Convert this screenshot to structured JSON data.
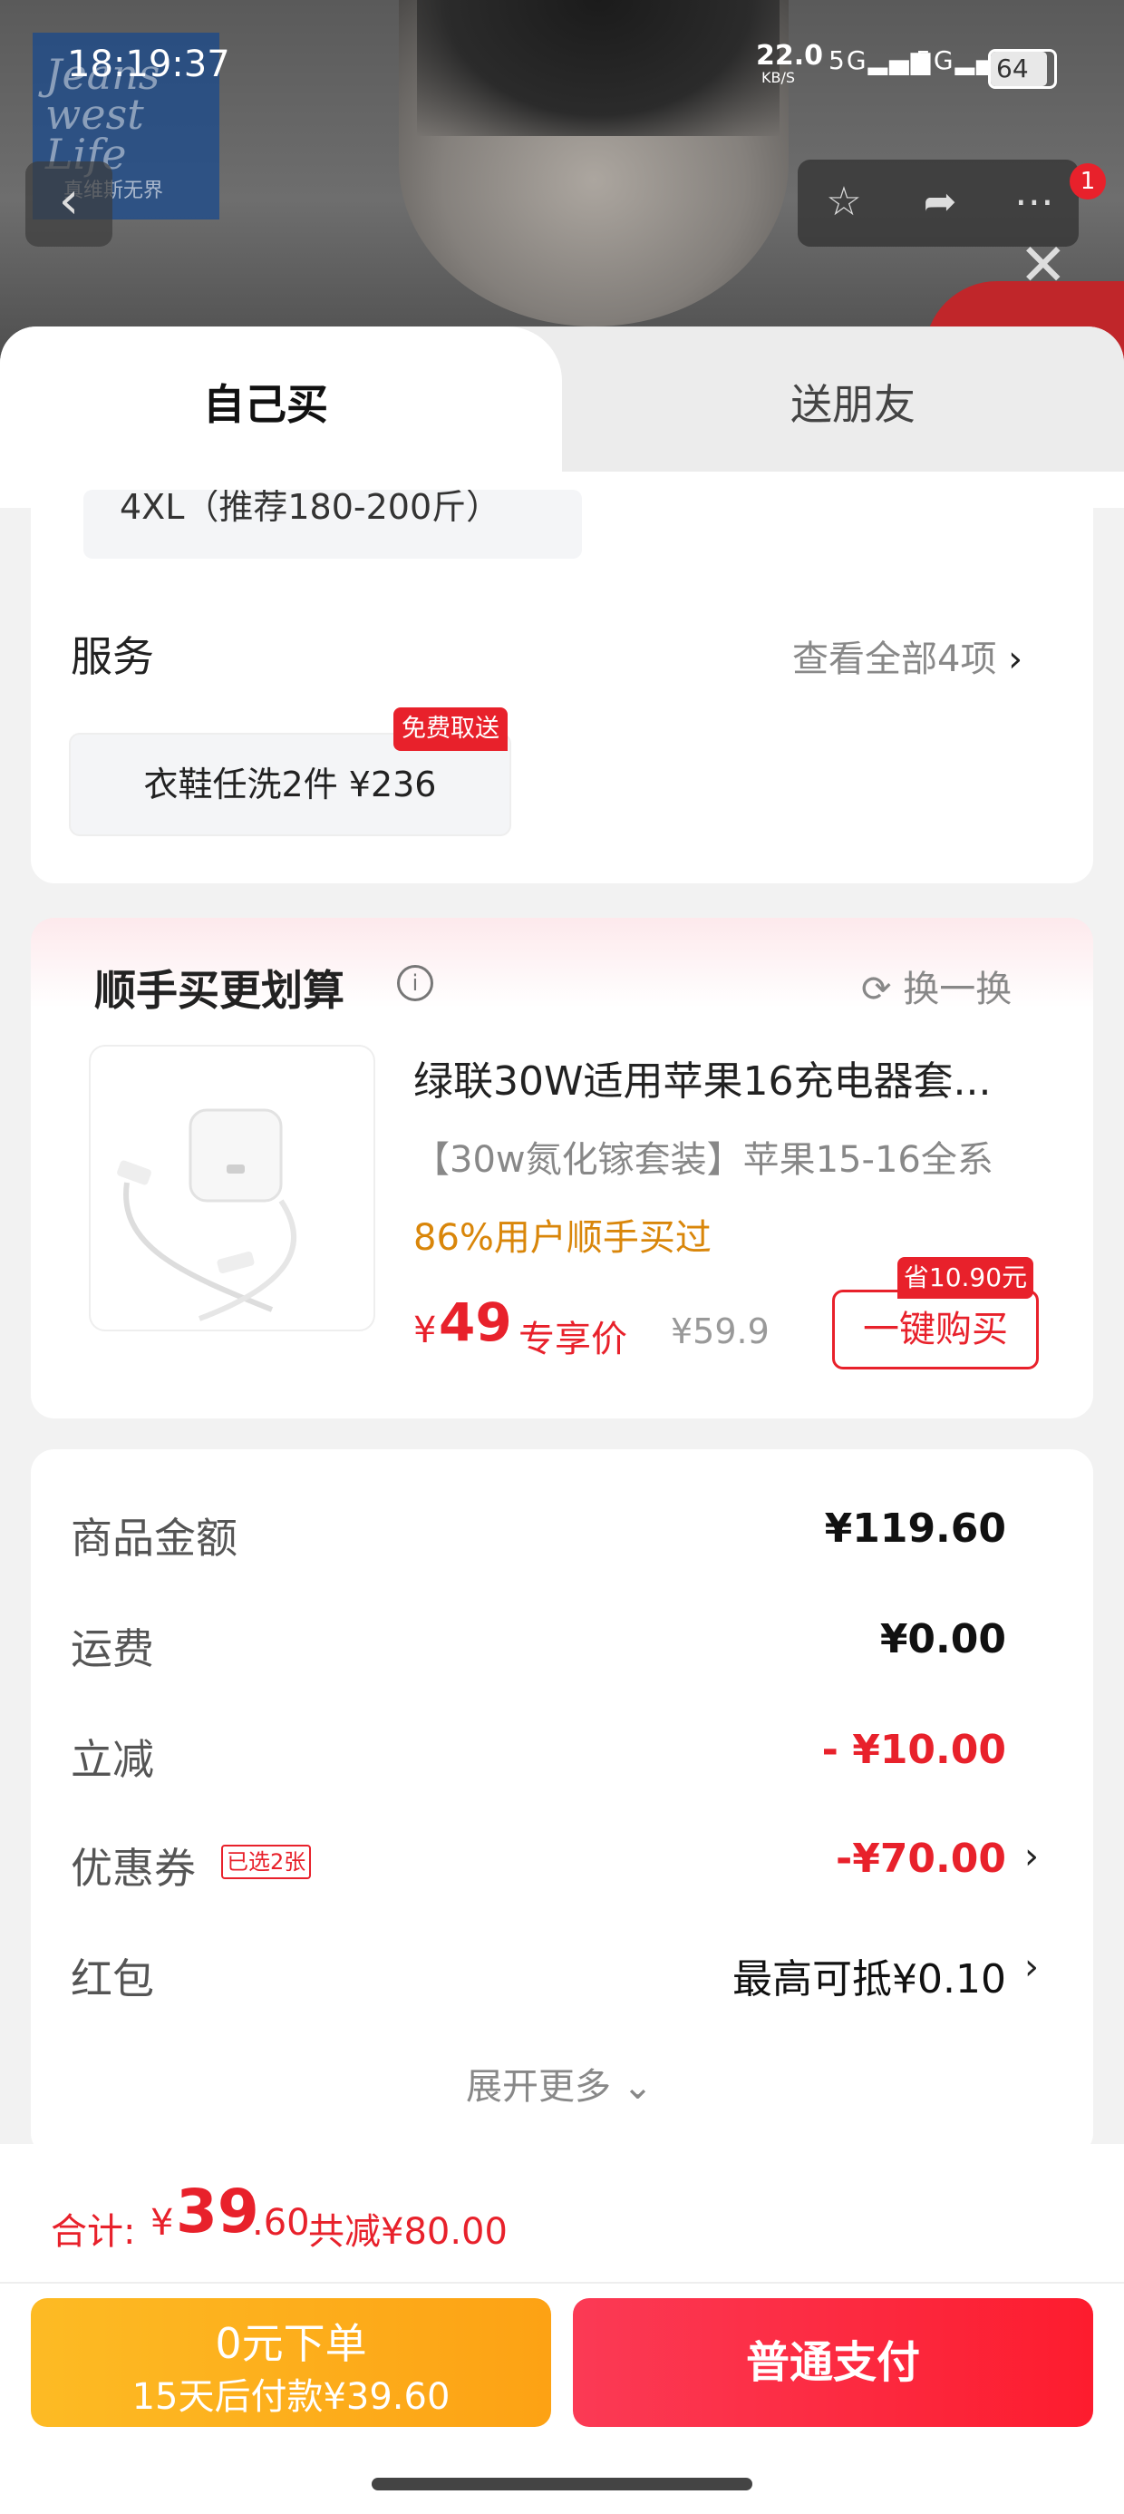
{
  "status_bar": {
    "time": "18:19:37",
    "net_speed": "22.0",
    "net_unit": "KB/S",
    "sig1": "5G",
    "sig2": "5G",
    "battery": "64"
  },
  "header": {
    "logo_text": "Jeans west Life",
    "logo_sub": "真维斯无界",
    "badge_count": "1"
  },
  "tabs": {
    "self": "自己买",
    "gift": "送朋友"
  },
  "size": {
    "partial_text": "4XL（推荐180-200斤）"
  },
  "service": {
    "title": "服务",
    "view_all": "查看全部4项",
    "chip_label": "衣鞋任洗2件  ¥236",
    "chip_tag": "免费取送"
  },
  "recommend": {
    "title": "顺手买更划算",
    "swap": "换一换",
    "product_name": "绿联30W适用苹果16充电器套...",
    "product_sub": "【30w氮化镓套装】苹果15-16全系",
    "product_pct": "86%用户顺手买过",
    "price_symbol": "¥",
    "price": "49",
    "price_label": "专享价",
    "price_old": "¥59.9",
    "save_tag": "省10.90元",
    "buy_button": "一键购买"
  },
  "summary": {
    "rows": [
      {
        "label": "商品金额",
        "value": "¥119.60"
      },
      {
        "label": "运费",
        "value": "¥0.00"
      },
      {
        "label": "立减",
        "value": "- ¥10.00"
      },
      {
        "label": "优惠券",
        "value": "-¥70.00",
        "tag": "已选2张"
      },
      {
        "label": "红包",
        "value": "最高可抵¥0.10"
      }
    ],
    "expand": "展开更多"
  },
  "bottom": {
    "total_label": "合计:",
    "total_symbol": "¥",
    "total_int": "39",
    "total_dec": ".60",
    "total_save": "共减¥80.00",
    "zero_line1": "0元下单",
    "zero_line2": "15天后付款¥39.60",
    "pay_button": "普通支付"
  },
  "colors": {
    "accent": "#e8212b",
    "orange": "#d9860a",
    "yellow_btn": "#fdb21e",
    "red_btn": "#fd2a40"
  }
}
